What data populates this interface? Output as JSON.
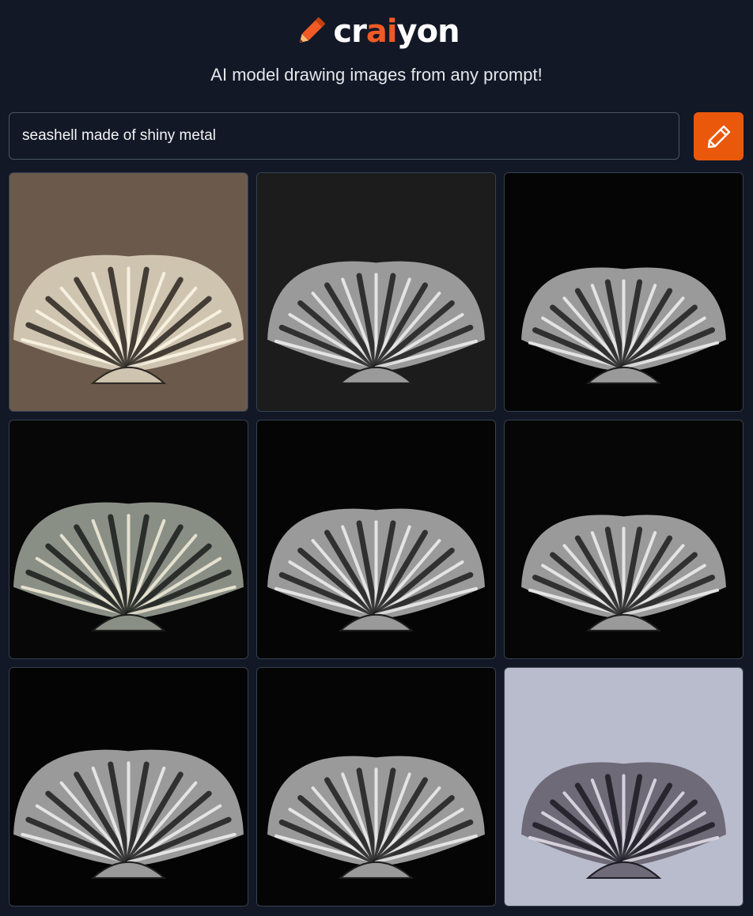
{
  "header": {
    "logo_prefix": "cr",
    "logo_accent": "ai",
    "logo_suffix": "yon",
    "tagline": "AI model drawing images from any prompt!"
  },
  "search": {
    "value": "seashell made of shiny metal",
    "button_icon": "pencil-icon"
  },
  "colors": {
    "background": "#121826",
    "accent": "#ea580c",
    "logo_accent": "#f15a24"
  },
  "results": [
    {
      "bg": "#6b5a4b",
      "shell": "light"
    },
    {
      "bg": "#1c1c1c",
      "shell": "silver"
    },
    {
      "bg": "#050505",
      "shell": "silver"
    },
    {
      "bg": "#070707",
      "shell": "spiky"
    },
    {
      "bg": "#050505",
      "shell": "silver"
    },
    {
      "bg": "#060606",
      "shell": "silver"
    },
    {
      "bg": "#040404",
      "shell": "silver"
    },
    {
      "bg": "#050505",
      "shell": "silver"
    },
    {
      "bg": "#b9bccc",
      "shell": "dark"
    }
  ]
}
